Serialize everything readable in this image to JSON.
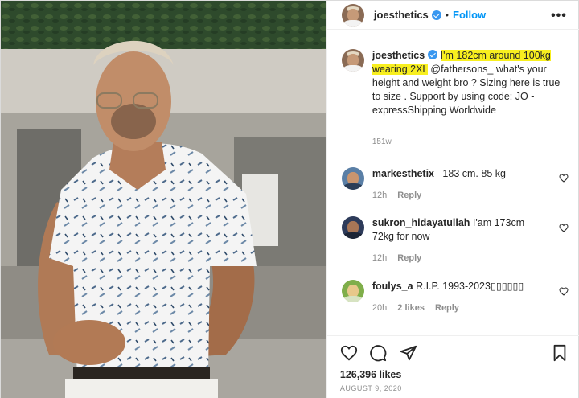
{
  "post": {
    "author": "joesthetics",
    "follow_label": "Follow",
    "dot": "•",
    "more_label": "•••",
    "caption": {
      "username": "joesthetics",
      "highlight": "I'm 182cm around 100kg wearing 2XL",
      "rest": " @fathersons_ what's your height and weight bro ? Sizing here is true to size . Support by using code: JO - expressShipping Worldwide",
      "time": "151w"
    },
    "comments": [
      {
        "username": "markesthetix_",
        "text": " 183 cm. 85 kg",
        "time": "12h",
        "likes": "",
        "reply": "Reply"
      },
      {
        "username": "sukron_hidayatullah",
        "text": " I'am 173cm 72kg for now",
        "time": "12h",
        "likes": "",
        "reply": "Reply"
      },
      {
        "username": "foulys_a",
        "text": " R.I.P. 1993-2023▯▯▯▯▯▯",
        "time": "20h",
        "likes": "2 likes",
        "reply": "Reply"
      }
    ],
    "likes": "126,396 likes",
    "date": "AUGUST 9, 2020"
  },
  "icons": {
    "more": "more-options-icon",
    "verified": "verified-badge-icon",
    "like": "heart-icon",
    "comment": "comment-icon",
    "share": "share-icon",
    "save": "bookmark-icon"
  },
  "colors": {
    "follow": "#0095f6",
    "highlight": "#f8ef1f",
    "verified": "#3897f0"
  }
}
